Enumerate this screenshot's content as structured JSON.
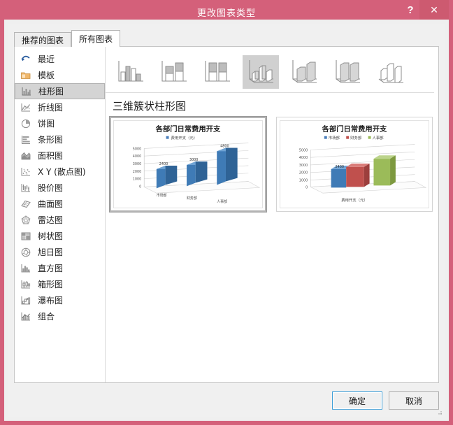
{
  "window": {
    "title": "更改图表类型",
    "help_label": "?",
    "close_label": "✕",
    "titlebar_color": "#d4607a",
    "close_color": "#cd5a70"
  },
  "tabs": [
    {
      "label": "推荐的图表",
      "active": false
    },
    {
      "label": "所有图表",
      "active": true
    }
  ],
  "sidebar": {
    "items": [
      {
        "label": "最近",
        "icon": "recent-icon",
        "selected": false
      },
      {
        "label": "模板",
        "icon": "template-folder-icon",
        "selected": false
      },
      {
        "label": "柱形图",
        "icon": "column-chart-icon",
        "selected": true
      },
      {
        "label": "折线图",
        "icon": "line-chart-icon",
        "selected": false
      },
      {
        "label": "饼图",
        "icon": "pie-chart-icon",
        "selected": false
      },
      {
        "label": "条形图",
        "icon": "bar-chart-icon",
        "selected": false
      },
      {
        "label": "面积图",
        "icon": "area-chart-icon",
        "selected": false
      },
      {
        "label": "X Y (散点图)",
        "icon": "scatter-chart-icon",
        "selected": false
      },
      {
        "label": "股价图",
        "icon": "stock-chart-icon",
        "selected": false
      },
      {
        "label": "曲面图",
        "icon": "surface-chart-icon",
        "selected": false
      },
      {
        "label": "雷达图",
        "icon": "radar-chart-icon",
        "selected": false
      },
      {
        "label": "树状图",
        "icon": "treemap-chart-icon",
        "selected": false
      },
      {
        "label": "旭日图",
        "icon": "sunburst-chart-icon",
        "selected": false
      },
      {
        "label": "直方图",
        "icon": "histogram-chart-icon",
        "selected": false
      },
      {
        "label": "箱形图",
        "icon": "boxplot-chart-icon",
        "selected": false
      },
      {
        "label": "瀑布图",
        "icon": "waterfall-chart-icon",
        "selected": false
      },
      {
        "label": "组合",
        "icon": "combo-chart-icon",
        "selected": false
      }
    ]
  },
  "type_strip": {
    "items": [
      {
        "name": "clustered-column",
        "selected": false
      },
      {
        "name": "stacked-column",
        "selected": false
      },
      {
        "name": "100-percent-stacked-column",
        "selected": false
      },
      {
        "name": "3d-clustered-column",
        "selected": true
      },
      {
        "name": "3d-stacked-column",
        "selected": false
      },
      {
        "name": "3d-100-percent-stacked-column",
        "selected": false
      },
      {
        "name": "3d-column",
        "selected": false
      }
    ]
  },
  "subtitle": "三维簇状柱形图",
  "previews": [
    {
      "name": "preview-3d-clustered-by-category",
      "selected": true
    },
    {
      "name": "preview-3d-clustered-by-series",
      "selected": false
    }
  ],
  "footer": {
    "ok_label": "确定",
    "cancel_label": "取消"
  },
  "chart_data": [
    {
      "type": "bar",
      "title": "各部门日常费用开支",
      "legend": [
        "费用开支（元）"
      ],
      "legend_position": "top",
      "categories": [
        "市场部",
        "财务部",
        "人事部"
      ],
      "values": [
        2400,
        3000,
        4800
      ],
      "data_labels": [
        "2400",
        "3000",
        "4800"
      ],
      "yticks": [
        "0",
        "1000",
        "2000",
        "3000",
        "4000",
        "5000"
      ],
      "ylim": [
        0,
        5000
      ],
      "xlabel": "",
      "ylabel": "",
      "grid": true,
      "series_colors": [
        "#4a7ebb"
      ]
    },
    {
      "type": "bar",
      "title": "各部门日常费用开支",
      "legend": [
        "市场部",
        "财务部",
        "人事部"
      ],
      "legend_position": "top",
      "categories": [
        "费用开支（元）"
      ],
      "series": [
        {
          "name": "市场部",
          "values": [
            2400
          ]
        },
        {
          "name": "财务部",
          "values": [
            3000
          ]
        },
        {
          "name": "人事部",
          "values": [
            4800
          ]
        }
      ],
      "data_labels": [
        "2400"
      ],
      "yticks": [
        "0",
        "1000",
        "2000",
        "3000",
        "4000",
        "5000"
      ],
      "ylim": [
        0,
        5000
      ],
      "xlabel": "费用开支（元）",
      "ylabel": "",
      "grid": true,
      "series_colors": [
        "#4a7ebb",
        "#c0504d",
        "#9bbb59"
      ]
    }
  ]
}
